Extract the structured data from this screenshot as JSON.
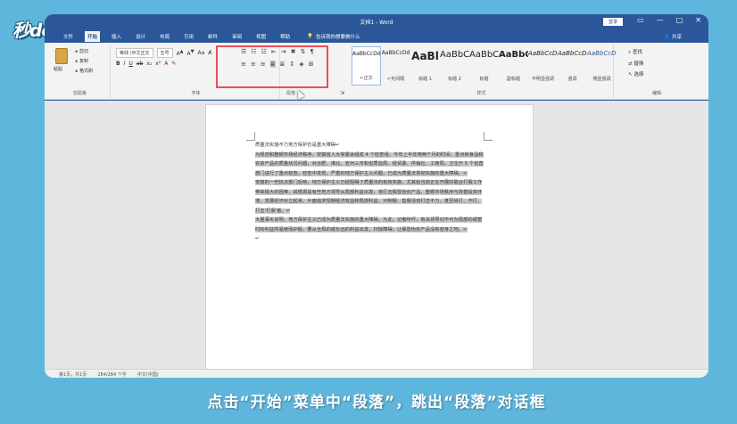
{
  "logo": "秒dong视频",
  "window": {
    "title": "文档1 - Word",
    "login": "登录",
    "buttons": [
      "▭",
      "—",
      "□",
      "✕"
    ]
  },
  "tabs": [
    "文件",
    "开始",
    "插入",
    "设计",
    "布局",
    "引用",
    "邮件",
    "审阅",
    "视图",
    "帮助"
  ],
  "active_tab": "开始",
  "tell_me": "告诉我你想要做什么",
  "share": "共享",
  "clipboard": {
    "paste": "粘贴",
    "cut": "剪切",
    "copy": "复制",
    "format_painter": "格式刷",
    "label": "剪贴板"
  },
  "font": {
    "name": "等线 (中文正文",
    "size": "五号",
    "label": "字体"
  },
  "paragraph": {
    "label": "段落",
    "launcher": "⇲"
  },
  "styles": {
    "label": "样式",
    "items": [
      {
        "sample": "AaBbCcDd",
        "name": "↵正文"
      },
      {
        "sample": "AaBbCcDd",
        "name": "↵无间隔"
      },
      {
        "sample": "AaBl",
        "name": "标题 1"
      },
      {
        "sample": "AaBbC",
        "name": "标题 2"
      },
      {
        "sample": "AaBbC",
        "name": "标题"
      },
      {
        "sample": "AaBbC",
        "name": "副标题"
      },
      {
        "sample": "AaBbCcDd",
        "name": "不明显强调"
      },
      {
        "sample": "AaBbCcDd",
        "name": "强调"
      },
      {
        "sample": "AaBbCcDd",
        "name": "明显强调"
      }
    ]
  },
  "editing": {
    "find": "查找",
    "replace": "替换",
    "select": "选择",
    "label": "编辑"
  },
  "document": {
    "title_line": "质量法实施不力地方保护仍是重大障碍↵",
    "para1": "为规范和整顿市场经济秩序，安徽省人大常委会组成 4 个检查组，今年上半年用两个月的时间，重点就食品和农资产品的质量状况问题，对合肥、淮北、宣州三市和省质监局、经贸委、供销社、工商局、卫生厅 5 个省直部门进行了重点检查。检查中发现，严重的地方保护主义问题，已成为质量法贯彻实施的重大障碍。↵",
    "para2": "安徽的一些执法部门反映，地方保护主义已经阻碍了质量法的有效实施，尤其给当前正在开展的联合打假工作带来极大的困难，其根源是有些地方领导从局部利益出发，将打击假冒伪劣产品、整顿市场秩序与改善投资环境、发展经济对立起来，片面追求短期经济效益和局部利益，对制假、售假活动打击不力，甚至纵打、不打、打击'打假'者。↵",
    "para3": "大量事实说明，地方保护主义已成为质量法实施的重大障碍。为此，记者呼吁，有关领导切不可为局部的或暂时的利益所驱使而护假，要从全局的或长远的利益出发，扫除障碍，让假冒伪劣产品没有容身之地。↵",
    "end_mark": "↵"
  },
  "status": {
    "pages": "第1页，共1页",
    "words": "284/284 个字",
    "lang": "中文(中国)"
  },
  "caption": "点击“开始”菜单中“段落”，跳出“段落”对话框"
}
